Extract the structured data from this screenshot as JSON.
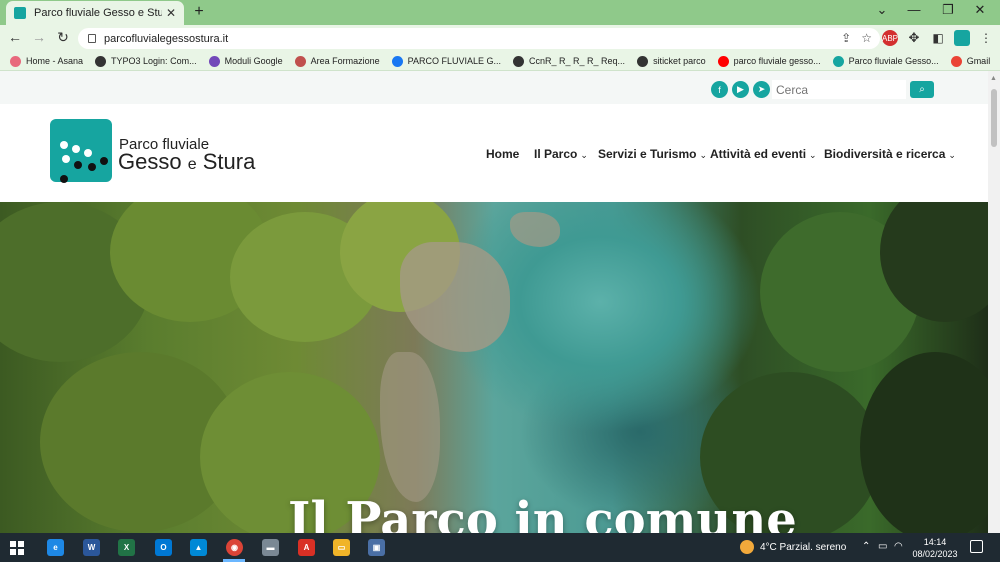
{
  "browser": {
    "tab_title": "Parco fluviale Gesso e Stura",
    "tab_close": "✕",
    "new_tab": "+",
    "url": "parcofluvialegessostura.it",
    "bookmarks": [
      {
        "label": "Home - Asana",
        "color": "#e8697d"
      },
      {
        "label": "TYPO3 Login: Com...",
        "color": "#333333"
      },
      {
        "label": "Moduli Google",
        "color": "#7248b9"
      },
      {
        "label": "Area Formazione",
        "color": "#c0504d"
      },
      {
        "label": "PARCO FLUVIALE G...",
        "color": "#1877f2"
      },
      {
        "label": "CcnR_ R_ R_ R_ Req...",
        "color": "#333333"
      },
      {
        "label": "siticket parco",
        "color": "#333333"
      },
      {
        "label": "parco fluviale gesso...",
        "color": "#ff0000"
      },
      {
        "label": "Parco fluviale Gesso...",
        "color": "#16a5a0"
      },
      {
        "label": "Gmail",
        "color": "#ea4335"
      }
    ],
    "extensions": {
      "abp": "ABP"
    }
  },
  "site": {
    "search_placeholder": "Cerca",
    "logo_line1": "Parco fluviale",
    "logo_line2": "Gesso",
    "logo_line2_small": "e",
    "logo_line2_end": "Stura",
    "nav": [
      {
        "label": "Home",
        "has_dropdown": false
      },
      {
        "label": "Il Parco",
        "has_dropdown": true
      },
      {
        "label": "Servizi e Turismo",
        "has_dropdown": true
      },
      {
        "label": "Attività ed eventi",
        "has_dropdown": true
      },
      {
        "label": "Biodiversità e ricerca",
        "has_dropdown": true
      }
    ],
    "hero_title": "Il Parco in comune",
    "accent_color": "#16a5a0"
  },
  "taskbar": {
    "weather": "4°C  Parzial. sereno",
    "time": "14:14",
    "date": "08/02/2023",
    "apps": [
      {
        "name": "internet-explorer",
        "label": "e",
        "color": "#1e88e5"
      },
      {
        "name": "word",
        "label": "W",
        "color": "#2b579a"
      },
      {
        "name": "excel",
        "label": "X",
        "color": "#217346"
      },
      {
        "name": "outlook",
        "label": "O",
        "color": "#0078d4"
      },
      {
        "name": "azure",
        "label": "▲",
        "color": "#0089d6"
      },
      {
        "name": "chrome",
        "label": "◉",
        "color": "#db4437"
      },
      {
        "name": "car-app",
        "label": "▬",
        "color": "#7a8894"
      },
      {
        "name": "acrobat",
        "label": "A",
        "color": "#d93025"
      },
      {
        "name": "file-explorer",
        "label": "▭",
        "color": "#f0b429"
      },
      {
        "name": "remote-app",
        "label": "▣",
        "color": "#4a6fa5"
      }
    ]
  }
}
